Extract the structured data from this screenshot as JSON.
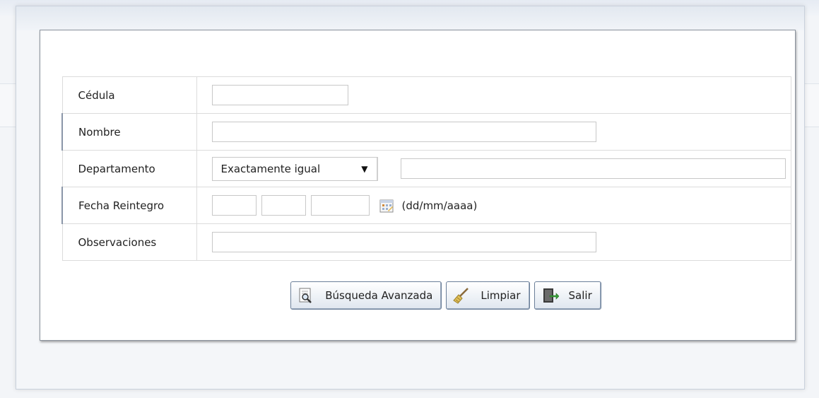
{
  "form": {
    "rows": [
      {
        "label": "Cédula",
        "value": ""
      },
      {
        "label": "Nombre",
        "value": ""
      },
      {
        "label": "Departamento",
        "value": ""
      },
      {
        "label": "Fecha Reintegro",
        "value": ""
      },
      {
        "label": "Observaciones",
        "value": ""
      }
    ],
    "departamento_match": {
      "selected": "Exactamente igual",
      "arrow": "▼"
    },
    "fecha": {
      "day": "",
      "month": "",
      "year": "",
      "format_hint": "(dd/mm/aaaa)",
      "icon": "calendar-icon"
    }
  },
  "buttons": [
    {
      "label": "Búsqueda Avanzada",
      "icon": "magnifier-document-icon"
    },
    {
      "label": "Limpiar",
      "icon": "broom-icon"
    },
    {
      "label": "Salir",
      "icon": "exit-door-icon"
    }
  ]
}
